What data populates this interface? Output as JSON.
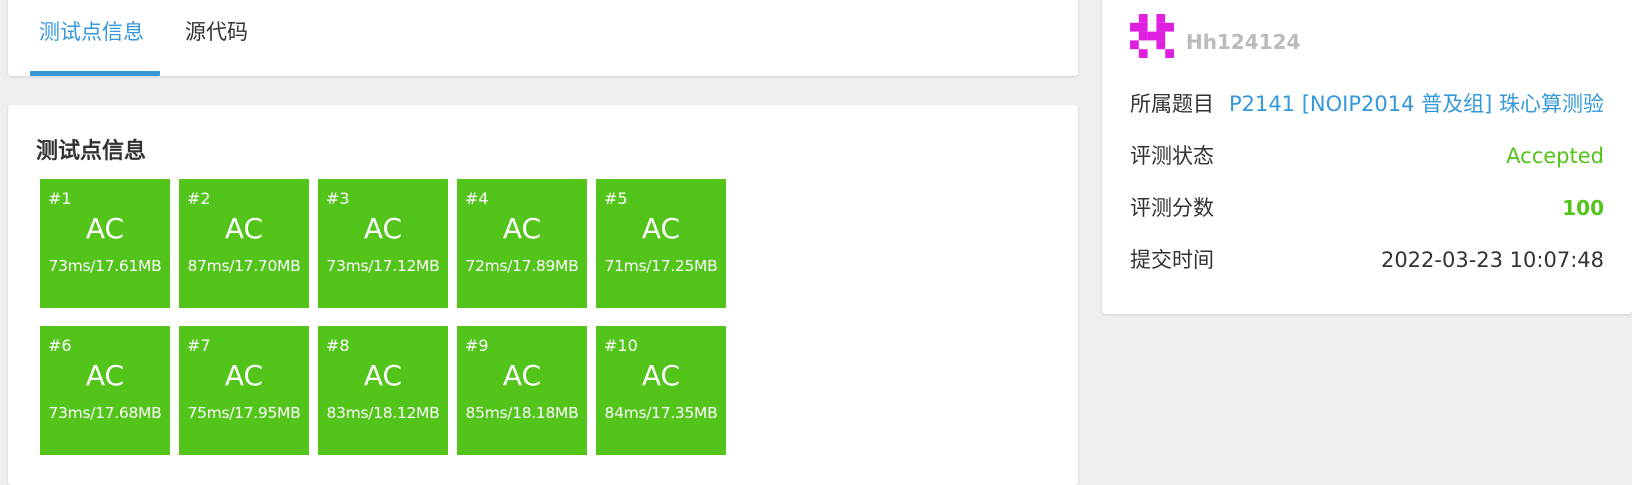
{
  "tabs": [
    {
      "label": "测试点信息",
      "active": true
    },
    {
      "label": "源代码",
      "active": false
    }
  ],
  "section_title": "测试点信息",
  "testcases": [
    {
      "id": "#1",
      "status": "AC",
      "result": "73ms/17.61MB"
    },
    {
      "id": "#2",
      "status": "AC",
      "result": "87ms/17.70MB"
    },
    {
      "id": "#3",
      "status": "AC",
      "result": "73ms/17.12MB"
    },
    {
      "id": "#4",
      "status": "AC",
      "result": "72ms/17.89MB"
    },
    {
      "id": "#5",
      "status": "AC",
      "result": "71ms/17.25MB"
    },
    {
      "id": "#6",
      "status": "AC",
      "result": "73ms/17.68MB"
    },
    {
      "id": "#7",
      "status": "AC",
      "result": "75ms/17.95MB"
    },
    {
      "id": "#8",
      "status": "AC",
      "result": "83ms/18.12MB"
    },
    {
      "id": "#9",
      "status": "AC",
      "result": "85ms/18.18MB"
    },
    {
      "id": "#10",
      "status": "AC",
      "result": "84ms/17.35MB"
    }
  ],
  "user": {
    "name": "Hh124124"
  },
  "info": {
    "problem_label": "所属题目",
    "problem_value": "P2141 [NOIP2014 普及组] 珠心算测验",
    "status_label": "评测状态",
    "status_value": "Accepted",
    "score_label": "评测分数",
    "score_value": "100",
    "time_label": "提交时间",
    "time_value": "2022-03-23 10:07:48"
  },
  "colors": {
    "accent": "#3498db",
    "ac_green": "#52c41a",
    "avatar_magenta": "#e020e0"
  }
}
